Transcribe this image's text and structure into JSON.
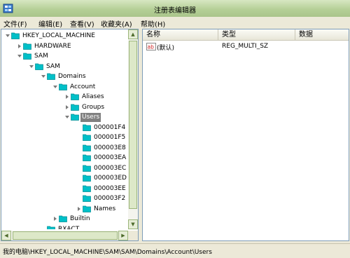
{
  "window": {
    "title": "注册表编辑器"
  },
  "menu": [
    {
      "label": "文件(F)"
    },
    {
      "label": "编辑(E)"
    },
    {
      "label": "查看(V)"
    },
    {
      "label": "收藏夹(A)"
    },
    {
      "label": "帮助(H)"
    }
  ],
  "tree": [
    {
      "label": "HKEY_LOCAL_MACHINE",
      "level": 0,
      "toggle": "expanded"
    },
    {
      "label": "HARDWARE",
      "level": 1,
      "toggle": "collapsed"
    },
    {
      "label": "SAM",
      "level": 1,
      "toggle": "expanded"
    },
    {
      "label": "SAM",
      "level": 2,
      "toggle": "expanded"
    },
    {
      "label": "Domains",
      "level": 3,
      "toggle": "expanded"
    },
    {
      "label": "Account",
      "level": 4,
      "toggle": "expanded"
    },
    {
      "label": "Aliases",
      "level": 5,
      "toggle": "collapsed"
    },
    {
      "label": "Groups",
      "level": 5,
      "toggle": "collapsed"
    },
    {
      "label": "Users",
      "level": 5,
      "toggle": "expanded",
      "selected": true
    },
    {
      "label": "000001F4",
      "level": 6,
      "toggle": "none"
    },
    {
      "label": "000001F5",
      "level": 6,
      "toggle": "none"
    },
    {
      "label": "000003E8",
      "level": 6,
      "toggle": "none"
    },
    {
      "label": "000003EA",
      "level": 6,
      "toggle": "none"
    },
    {
      "label": "000003EC",
      "level": 6,
      "toggle": "none"
    },
    {
      "label": "000003ED",
      "level": 6,
      "toggle": "none"
    },
    {
      "label": "000003EE",
      "level": 6,
      "toggle": "none"
    },
    {
      "label": "000003F2",
      "level": 6,
      "toggle": "none"
    },
    {
      "label": "Names",
      "level": 6,
      "toggle": "collapsed"
    },
    {
      "label": "Builtin",
      "level": 4,
      "toggle": "collapsed"
    },
    {
      "label": "RXACT",
      "level": 3,
      "toggle": "none"
    }
  ],
  "list": {
    "columns": [
      "名称",
      "类型",
      "数据"
    ],
    "rows": [
      {
        "icon": "ab",
        "name": "(默认)",
        "type": "REG_MULTI_SZ",
        "data": ""
      }
    ]
  },
  "status": {
    "path": "我的电脑\\HKEY_LOCAL_MACHINE\\SAM\\SAM\\Domains\\Account\\Users"
  },
  "colors": {
    "title_bar": "#b5cf97",
    "folder": "#00c0c8",
    "selection": "#808080"
  }
}
